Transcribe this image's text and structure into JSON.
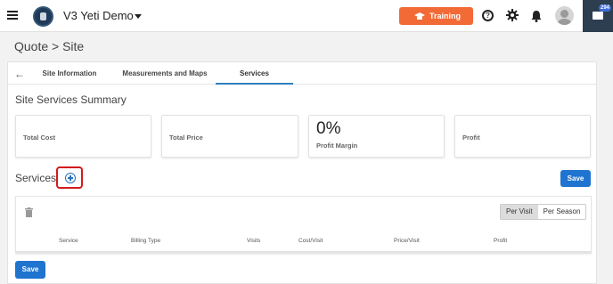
{
  "app": {
    "title": "V3 Yeti Demo",
    "training_label": "Training",
    "notification_count": "294",
    "colors": {
      "accent": "#1f74cf",
      "training": "#f26a36",
      "highlight": "#d21b1b"
    }
  },
  "page": {
    "breadcrumb": "Quote > Site"
  },
  "tabs": [
    {
      "label": "Site Information"
    },
    {
      "label": "Measurements and Maps"
    },
    {
      "label": "Services",
      "active": true
    }
  ],
  "summary": {
    "title": "Site Services Summary",
    "cards": [
      {
        "label": "Total Cost",
        "value": ""
      },
      {
        "label": "Total Price",
        "value": ""
      },
      {
        "label": "Profit Margin",
        "value": "0%"
      },
      {
        "label": "Profit",
        "value": ""
      }
    ]
  },
  "services": {
    "title": "Services",
    "save_label": "Save",
    "toggle": {
      "options": [
        "Per Visit",
        "Per Season"
      ],
      "selected": "Per Visit"
    },
    "columns": [
      "Service",
      "Billing Type",
      "Visits",
      "Cost/Visit",
      "Price/Visit",
      "Profit"
    ]
  },
  "footer": {
    "save_label": "Save"
  },
  "icons": [
    "menu-icon",
    "logo-icon",
    "chevron-down-icon",
    "graduation-cap-icon",
    "help-icon",
    "gear-icon",
    "bell-icon",
    "avatar-icon",
    "chat-icon",
    "back-arrow-icon",
    "add-circle-icon",
    "trash-icon"
  ]
}
